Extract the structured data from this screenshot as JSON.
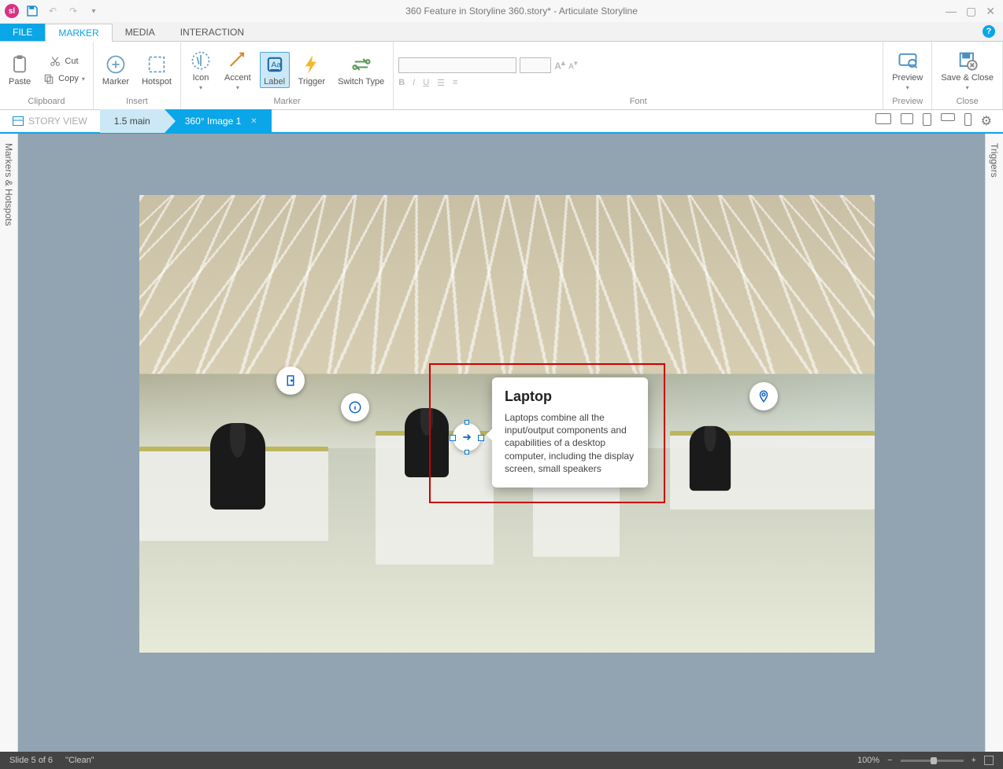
{
  "title": "360 Feature in Storyline 360.story* -  Articulate Storyline",
  "menuTabs": {
    "file": "FILE",
    "marker": "MARKER",
    "media": "MEDIA",
    "interaction": "INTERACTION"
  },
  "ribbon": {
    "clipboard": {
      "paste": "Paste",
      "cut": "Cut",
      "copy": "Copy",
      "label": "Clipboard"
    },
    "insert": {
      "marker": "Marker",
      "hotspot": "Hotspot",
      "label": "Insert"
    },
    "marker": {
      "icon": "Icon",
      "accent": "Accent",
      "labelBtn": "Label",
      "trigger": "Trigger",
      "switch": "Switch Type",
      "label": "Marker"
    },
    "font": {
      "label": "Font"
    },
    "preview": {
      "preview": "Preview",
      "label": "Preview"
    },
    "close": {
      "save": "Save & Close",
      "label": "Close"
    }
  },
  "storyView": "STORY VIEW",
  "crumb1": "1.5 main",
  "crumb2": "360° Image 1",
  "sideLeft": "Markers & Hotspots",
  "sideRight": "Triggers",
  "callout": {
    "title": "Laptop",
    "body": "Laptops combine all the input/output components and capabilities of a desktop computer, including the display screen, small speakers"
  },
  "status": {
    "slide": "Slide 5 of 6",
    "layout": "\"Clean\"",
    "zoom": "100%"
  }
}
